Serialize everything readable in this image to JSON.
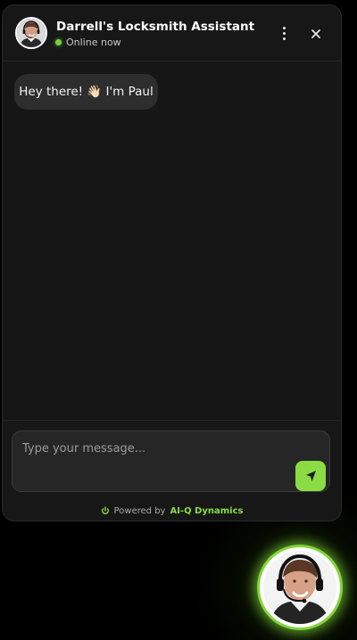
{
  "header": {
    "title": "Darrell's Locksmith Assistant",
    "status": "Online now",
    "status_color": "#73d43a",
    "avatar_icon": "agent-avatar",
    "menu_icon": "more-vertical-icon",
    "close_icon": "close-icon"
  },
  "messages": [
    {
      "sender": "assistant",
      "text": "Hey there! 👋🏻 I'm Paul"
    }
  ],
  "composer": {
    "placeholder": "Type your message...",
    "value": "",
    "send_icon": "send-icon"
  },
  "footer": {
    "prefix": "Powered by",
    "brand": "AI-Q Dynamics",
    "icon": "power-icon"
  },
  "launcher": {
    "icon": "agent-avatar",
    "ring_color": "#82d53b"
  },
  "theme": {
    "background": "#000000",
    "panel": "#161616",
    "bubble": "#2d2d2d",
    "accent": "#8bdc43",
    "text": "#ffffff"
  }
}
